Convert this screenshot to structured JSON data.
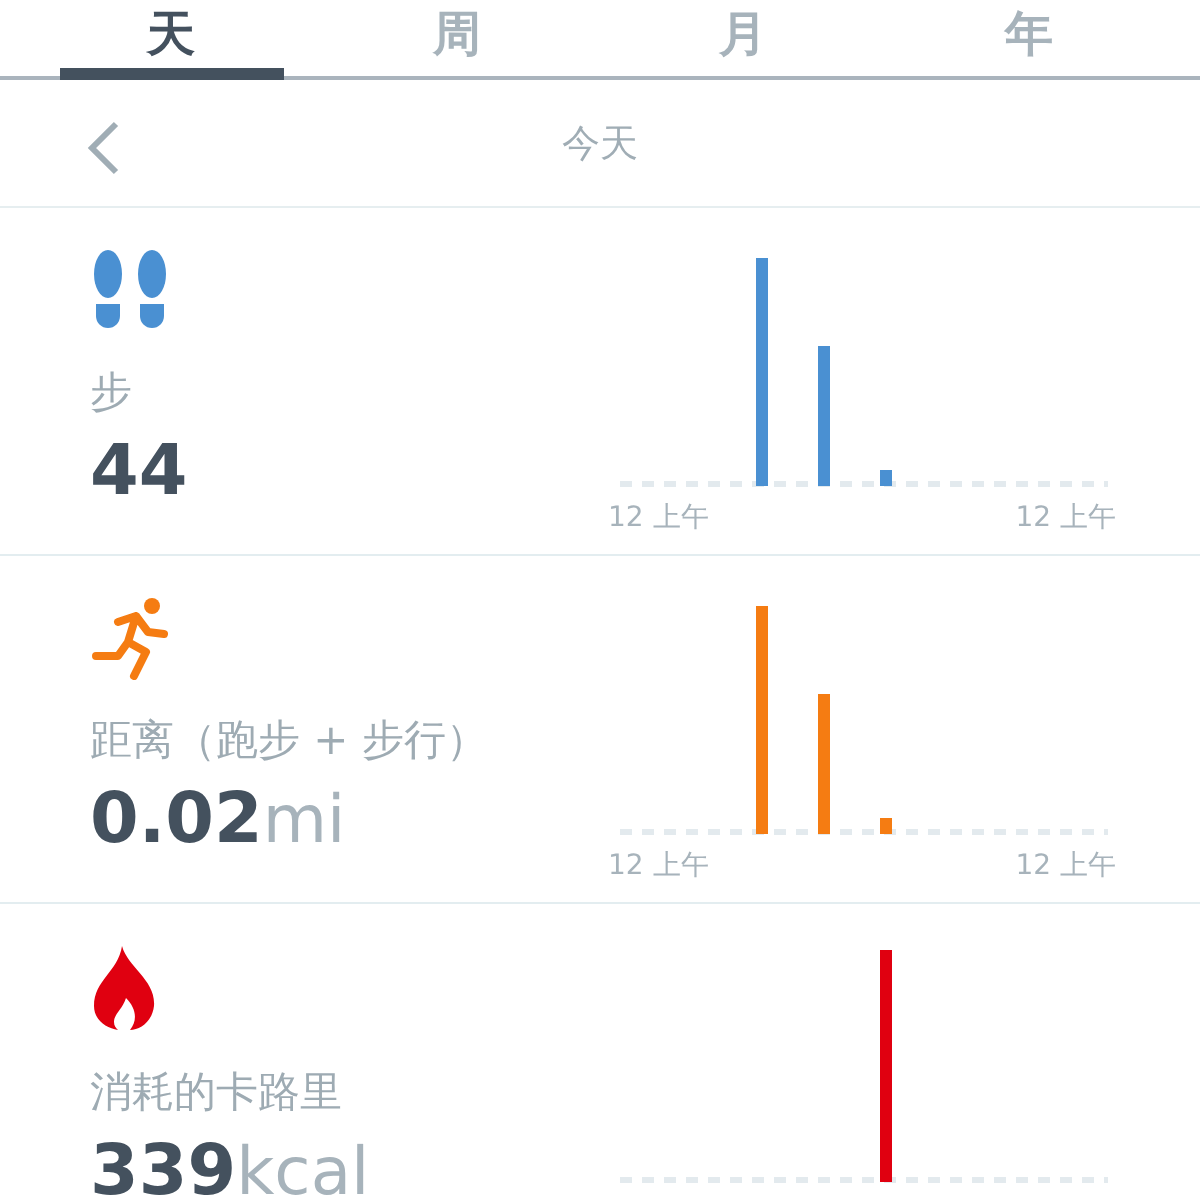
{
  "tabs": [
    {
      "label": "天",
      "selected": true
    },
    {
      "label": "周",
      "selected": false
    },
    {
      "label": "月",
      "selected": false
    },
    {
      "label": "年",
      "selected": false
    }
  ],
  "header": {
    "title": "今天"
  },
  "cards": [
    {
      "kind": "steps",
      "color": "#4a90d2",
      "label": "步",
      "value": "44",
      "x_labels": [
        "12 上午",
        "12 上午"
      ]
    },
    {
      "kind": "distance",
      "color": "#f57c12",
      "label": "距离（跑步 + 步行）",
      "value": "0.02",
      "unit": "mi",
      "x_labels": [
        "12 上午",
        "12 上午"
      ]
    },
    {
      "kind": "calories",
      "color": "#e00010",
      "label": "消耗的卡路里",
      "value": "339",
      "unit": "kcal"
    }
  ]
}
